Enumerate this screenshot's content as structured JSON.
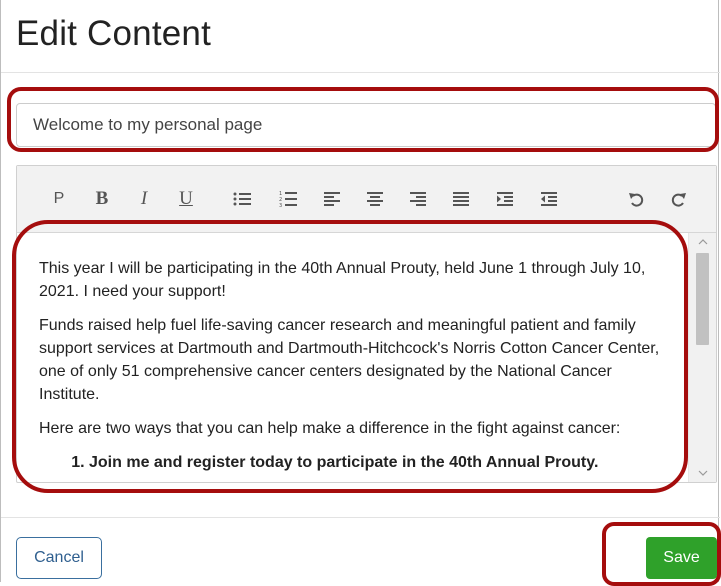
{
  "dialog": {
    "title": "Edit Content"
  },
  "title_field": {
    "value": "Welcome to my personal page"
  },
  "toolbar": {
    "paragraph": "P",
    "bold": "B",
    "italic": "I",
    "underline": "U",
    "icons": [
      "bullet-list-icon",
      "numbered-list-icon",
      "align-left-icon",
      "align-center-icon",
      "align-right-icon",
      "align-justify-icon",
      "indent-icon",
      "outdent-icon",
      "undo-icon",
      "redo-icon"
    ]
  },
  "content": {
    "paragraphs": [
      "This year I will be participating in the 40th Annual Prouty, held June 1 through July 10, 2021. I need your support!",
      "Funds raised help fuel life-saving cancer research and meaningful patient and family support services at Dartmouth and Dartmouth-Hitchcock's Norris Cotton Cancer Center, one of only 51 comprehensive cancer centers designated by the National Cancer Institute.",
      "Here are two ways that you can help make a difference in the fight against cancer:"
    ],
    "list_items": [
      "Join me and register today to participate in the 40th Annual Prouty."
    ]
  },
  "footer": {
    "cancel_label": "Cancel",
    "save_label": "Save"
  },
  "colors": {
    "annotation": "#a50d0d",
    "save_button": "#2fa12a",
    "cancel_border": "#3a6f9e"
  }
}
